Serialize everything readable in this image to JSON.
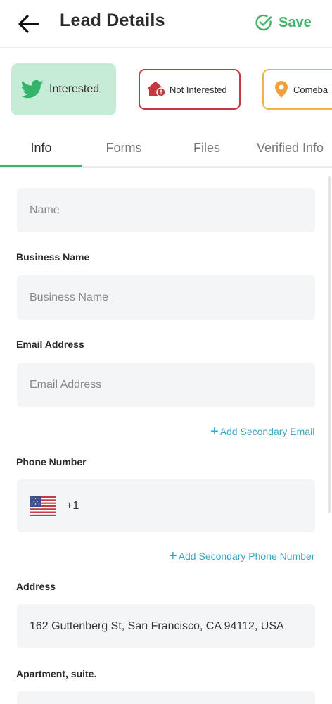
{
  "header": {
    "title": "Lead Details",
    "save_label": "Save"
  },
  "status_chips": [
    {
      "label": "Interested",
      "color": "#c6ecd6",
      "icon": "twitter-bird-icon"
    },
    {
      "label": "Not Interested",
      "color": "#c7373f",
      "icon": "house-alert-icon"
    },
    {
      "label": "Comeba",
      "color": "#f0b24a",
      "icon": "location-pin-icon"
    }
  ],
  "tabs": [
    {
      "label": "Info",
      "active": true
    },
    {
      "label": "Forms"
    },
    {
      "label": "Files"
    },
    {
      "label": "Verified Info"
    }
  ],
  "form": {
    "name_placeholder": "Name",
    "business_label": "Business Name",
    "business_placeholder": "Business Name",
    "email_label": "Email Address",
    "email_placeholder": "Email Address",
    "add_secondary_email": "Add Secondary Email",
    "phone_label": "Phone Number",
    "phone_code": "+1",
    "add_secondary_phone": "Add Secondary Phone Number",
    "address_label": "Address",
    "address_value": "162 Guttenberg St, San Francisco, CA 94112, USA",
    "apartment_label": "Apartment, suite."
  },
  "colors": {
    "accent_green": "#43b26b",
    "link_blue": "#3aa3c9",
    "field_bg": "#f4f5f7"
  }
}
